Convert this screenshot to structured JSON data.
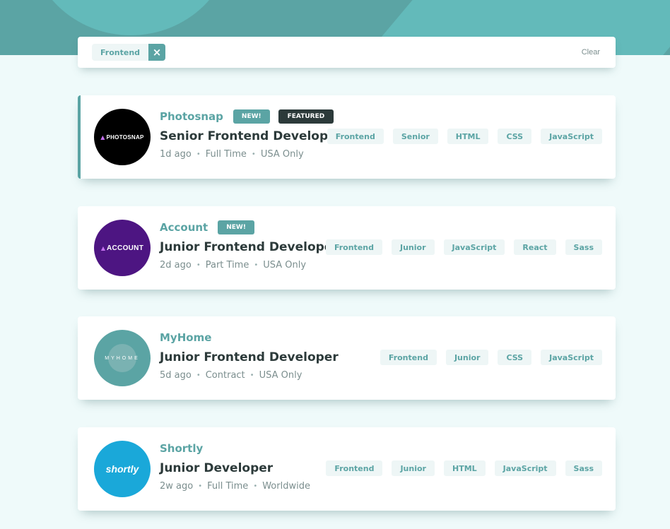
{
  "filter": {
    "active": [
      "Frontend"
    ],
    "remove_icon": "×",
    "clear_label": "Clear"
  },
  "jobs": [
    {
      "logo_text": "PHOTOSNAP",
      "logo_color": "#000000",
      "company": "Photosnap",
      "new_label": "NEW!",
      "featured_label": "FEATURED",
      "position": "Senior Frontend Developer",
      "posted": "1d ago",
      "contract": "Full Time",
      "location": "USA Only",
      "tags": [
        "Frontend",
        "Senior",
        "HTML",
        "CSS",
        "JavaScript"
      ]
    },
    {
      "logo_text": "ACCOUNT",
      "logo_color": "#4d1582",
      "company": "Account",
      "new_label": "NEW!",
      "position": "Junior Frontend Developer",
      "posted": "2d ago",
      "contract": "Part Time",
      "location": "USA Only",
      "tags": [
        "Frontend",
        "Junior",
        "JavaScript",
        "React",
        "Sass"
      ]
    },
    {
      "logo_text": "MYHOME",
      "logo_color": "#5ba4a4",
      "company": "MyHome",
      "position": "Junior Frontend Developer",
      "posted": "5d ago",
      "contract": "Contract",
      "location": "USA Only",
      "tags": [
        "Frontend",
        "Junior",
        "CSS",
        "JavaScript"
      ]
    },
    {
      "logo_text": "shortly",
      "logo_color": "#1aa8d9",
      "company": "Shortly",
      "position": "Junior Developer",
      "posted": "2w ago",
      "contract": "Full Time",
      "location": "Worldwide",
      "tags": [
        "Frontend",
        "Junior",
        "HTML",
        "JavaScript",
        "Sass"
      ]
    }
  ],
  "meta_separator": "•",
  "colors": {
    "primary": "#5ba4a4",
    "dark": "#2c3a3a",
    "background": "#effafa",
    "tag_background": "#eef6f6"
  }
}
